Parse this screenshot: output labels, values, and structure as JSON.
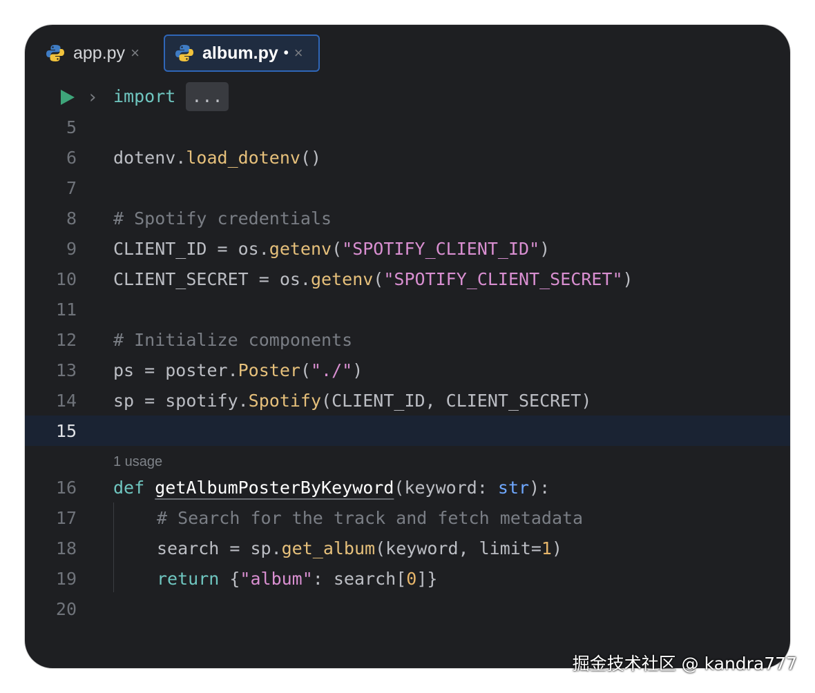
{
  "tabs": [
    {
      "label": "app.py",
      "close": "×"
    },
    {
      "label": "album.py",
      "modified": "•",
      "close": "×"
    }
  ],
  "gutter": {
    "import_keyword": "import",
    "folded": "...",
    "run_icon": "run-icon",
    "fold_icon": "chevron-right-icon"
  },
  "lines": {
    "5": "5",
    "6": "6",
    "7": "7",
    "8": "8",
    "9": "9",
    "10": "10",
    "11": "11",
    "12": "12",
    "13": "13",
    "14": "14",
    "15": "15",
    "16": "16",
    "17": "17",
    "18": "18",
    "19": "19",
    "20": "20"
  },
  "code": {
    "l6": [
      "dotenv.",
      "load_dotenv",
      "()"
    ],
    "l8": "# Spotify credentials",
    "l9": [
      "CLIENT_ID = os.",
      "getenv",
      "(",
      "\"SPOTIFY_CLIENT_ID\"",
      ")"
    ],
    "l10": [
      "CLIENT_SECRET = os.",
      "getenv",
      "(",
      "\"SPOTIFY_CLIENT_SECRET\"",
      ")"
    ],
    "l12": "# Initialize components",
    "l13": [
      "ps = poster.",
      "Poster",
      "(",
      "\"./\"",
      ")"
    ],
    "l14": [
      "sp = spotify.",
      "Spotify",
      "(CLIENT_ID, CLIENT_SECRET)"
    ],
    "usage_hint": "1 usage",
    "l16": [
      "def",
      " ",
      "getAlbumPosterByKeyword",
      "(keyword: ",
      "str",
      "):"
    ],
    "l17": "# Search for the track and fetch metadata",
    "l18": [
      "search = sp.",
      "get_album",
      "(keyword, limit=",
      "1",
      ")"
    ],
    "l19": [
      "return",
      " {",
      "\"album\"",
      ": search[",
      "0",
      "]}"
    ]
  },
  "watermark": "掘金技术社区 @ kandra777",
  "colors": {
    "background": "#1e1f22",
    "keyword": "#6fc6c0",
    "function": "#e6c07b",
    "string": "#d98fd1",
    "comment": "#7a7e85",
    "active_tab_border": "#2f66b8"
  }
}
